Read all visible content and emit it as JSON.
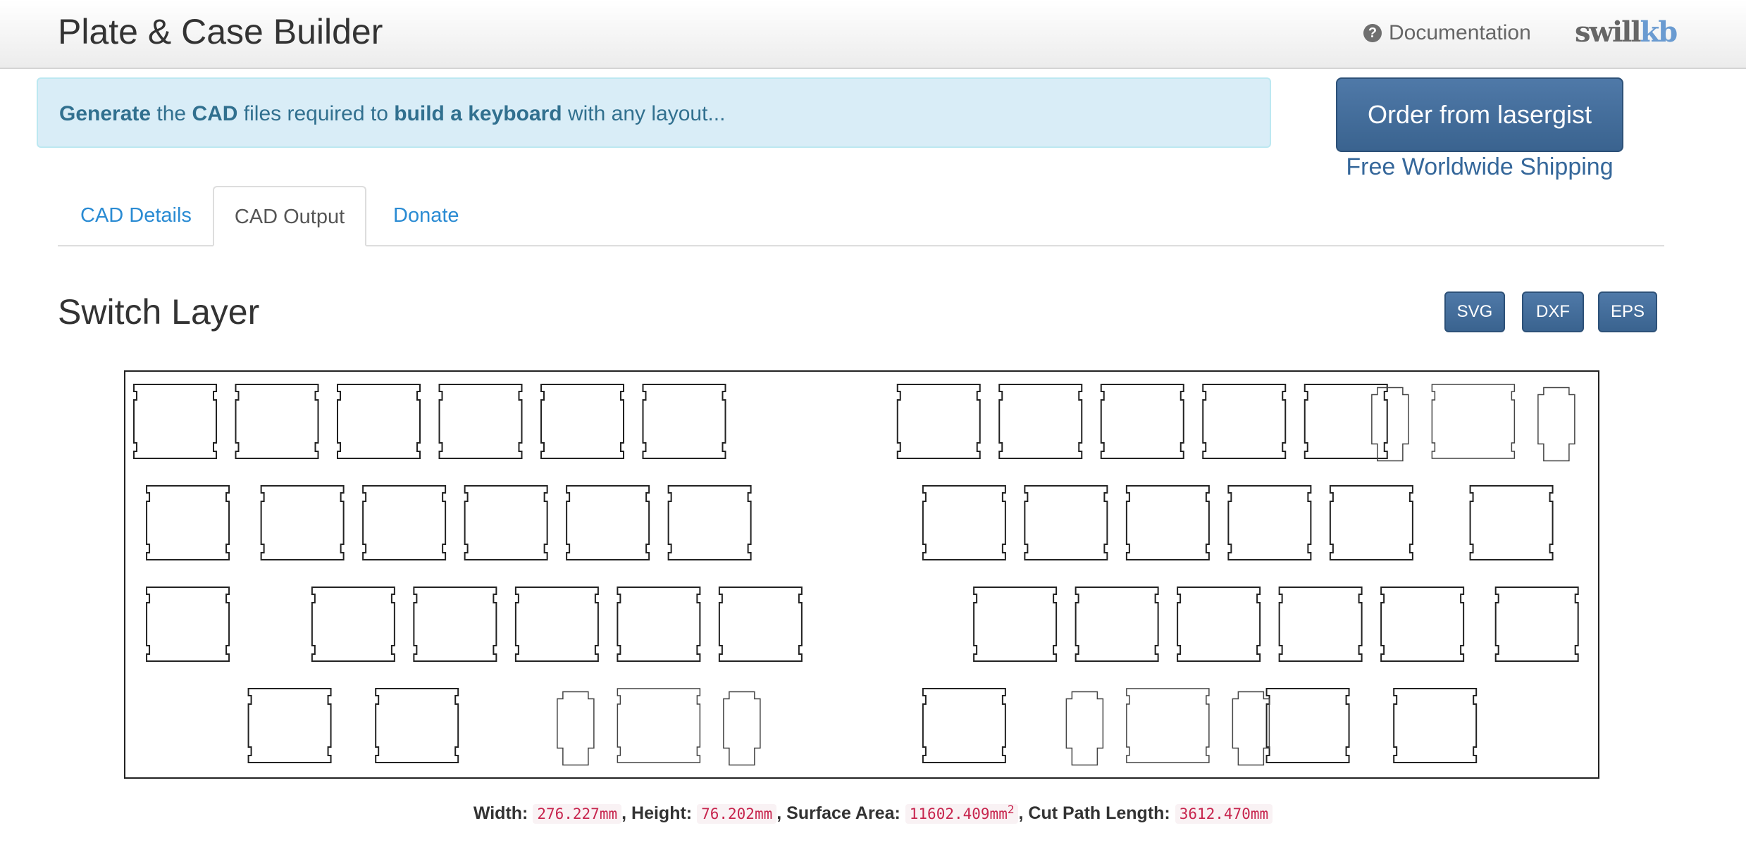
{
  "navbar": {
    "brand": "Plate & Case Builder",
    "documentation": "Documentation",
    "logo_part1": "swill",
    "logo_part2": "kb"
  },
  "alert": {
    "w1": "Generate",
    "t1": " the ",
    "w2": "CAD",
    "t2": " files required to ",
    "w3": "build a keyboard",
    "t3": " with any layout..."
  },
  "order": {
    "button": "Order from lasergist",
    "shipping": "Free Worldwide Shipping"
  },
  "tabs": [
    {
      "label": "CAD Details",
      "active": false
    },
    {
      "label": "CAD Output",
      "active": true
    },
    {
      "label": "Donate",
      "active": false
    }
  ],
  "section": {
    "title": "Switch Layer",
    "formats": [
      "SVG",
      "DXF",
      "EPS"
    ]
  },
  "stats": {
    "width_label": "Width:",
    "width_value": "276.227mm",
    "height_label": "Height:",
    "height_value": "76.202mm",
    "area_label": "Surface Area:",
    "area_value": "11602.409mm",
    "area_unit_exp": "2",
    "cut_label": "Cut Path Length:",
    "cut_value": "3612.470mm"
  },
  "plate": {
    "rows": [
      {
        "switches": [
          0,
          1,
          2,
          3,
          4,
          5,
          7.5,
          8.5,
          9.5,
          10.5,
          11.5
        ],
        "stabilized": [
          12.75
        ]
      },
      {
        "switches": [
          0.125,
          1.25,
          2.25,
          3.25,
          4.25,
          5.25,
          7.75,
          8.75,
          9.75,
          10.75,
          11.75,
          13.125
        ],
        "stabilized": []
      },
      {
        "switches": [
          0.125,
          1.75,
          2.75,
          3.75,
          4.75,
          5.75,
          8.25,
          9.25,
          10.25,
          11.25,
          12.25,
          13.375
        ],
        "stabilized": []
      },
      {
        "switches": [
          1.125,
          2.375,
          7.75,
          11.125,
          12.375
        ],
        "stabilized": [
          4.75,
          9.75
        ]
      }
    ]
  }
}
